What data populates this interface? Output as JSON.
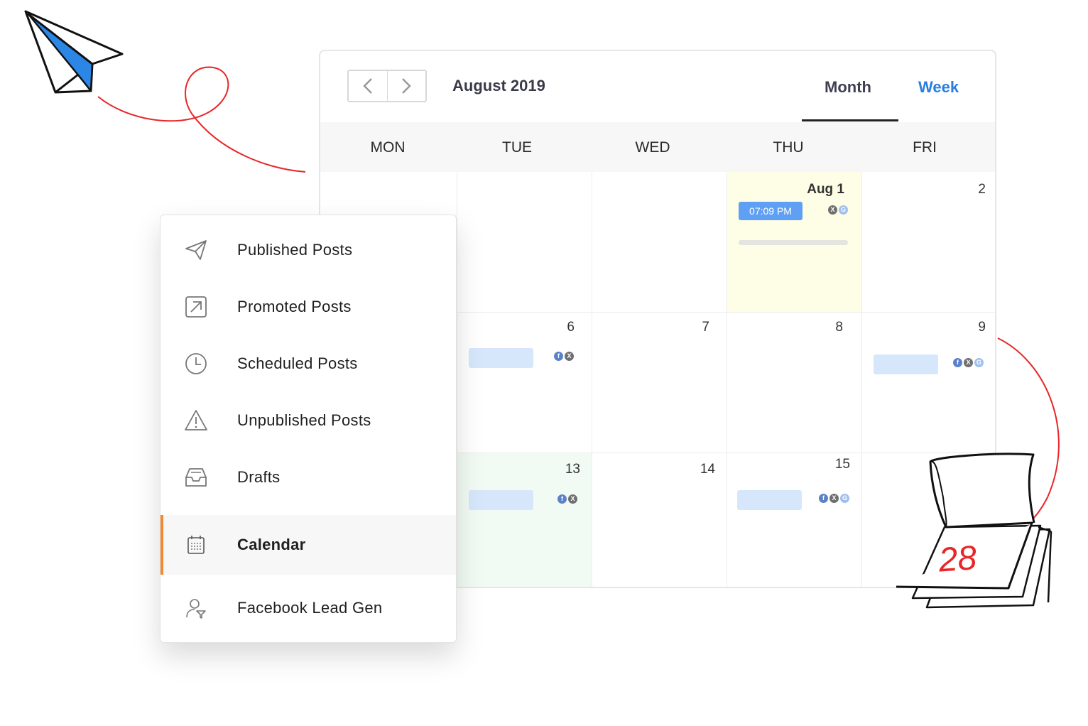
{
  "calendar": {
    "month_title": "August 2019",
    "prev_icon": "chevron-left-icon",
    "next_icon": "chevron-right-icon",
    "view_tabs": [
      {
        "label": "Month",
        "active": true
      },
      {
        "label": "Week",
        "active": false
      }
    ],
    "weekdays": [
      "MON",
      "TUE",
      "WED",
      "THU",
      "FRI"
    ],
    "week1": {
      "thu_label": "Aug 1",
      "thu_time": "07:09 PM",
      "fri_label": "2"
    },
    "week2": {
      "tue": "6",
      "wed": "7",
      "thu": "8",
      "fri": "9"
    },
    "week3": {
      "tue": "13",
      "wed": "14",
      "thu": "15"
    }
  },
  "menu": {
    "items": [
      {
        "label": "Published Posts",
        "icon": "paper-plane-icon"
      },
      {
        "label": "Promoted Posts",
        "icon": "arrow-up-right-icon"
      },
      {
        "label": "Scheduled Posts",
        "icon": "clock-icon"
      },
      {
        "label": "Unpublished Posts",
        "icon": "warning-icon"
      },
      {
        "label": "Drafts",
        "icon": "inbox-tray-icon"
      },
      {
        "label": "Calendar",
        "icon": "calendar-icon",
        "active": true
      },
      {
        "label": "Facebook Lead Gen",
        "icon": "user-filter-icon"
      }
    ]
  },
  "decor": {
    "calendar_page_number": "28"
  },
  "colors": {
    "accent_blue": "#2a7ee0",
    "badge_blue": "#5fa0f4",
    "menu_active_bar": "#f08a38",
    "today_bg": "#fefee6",
    "green_bg": "#f1fbf4",
    "decor_red": "#e8262a"
  }
}
